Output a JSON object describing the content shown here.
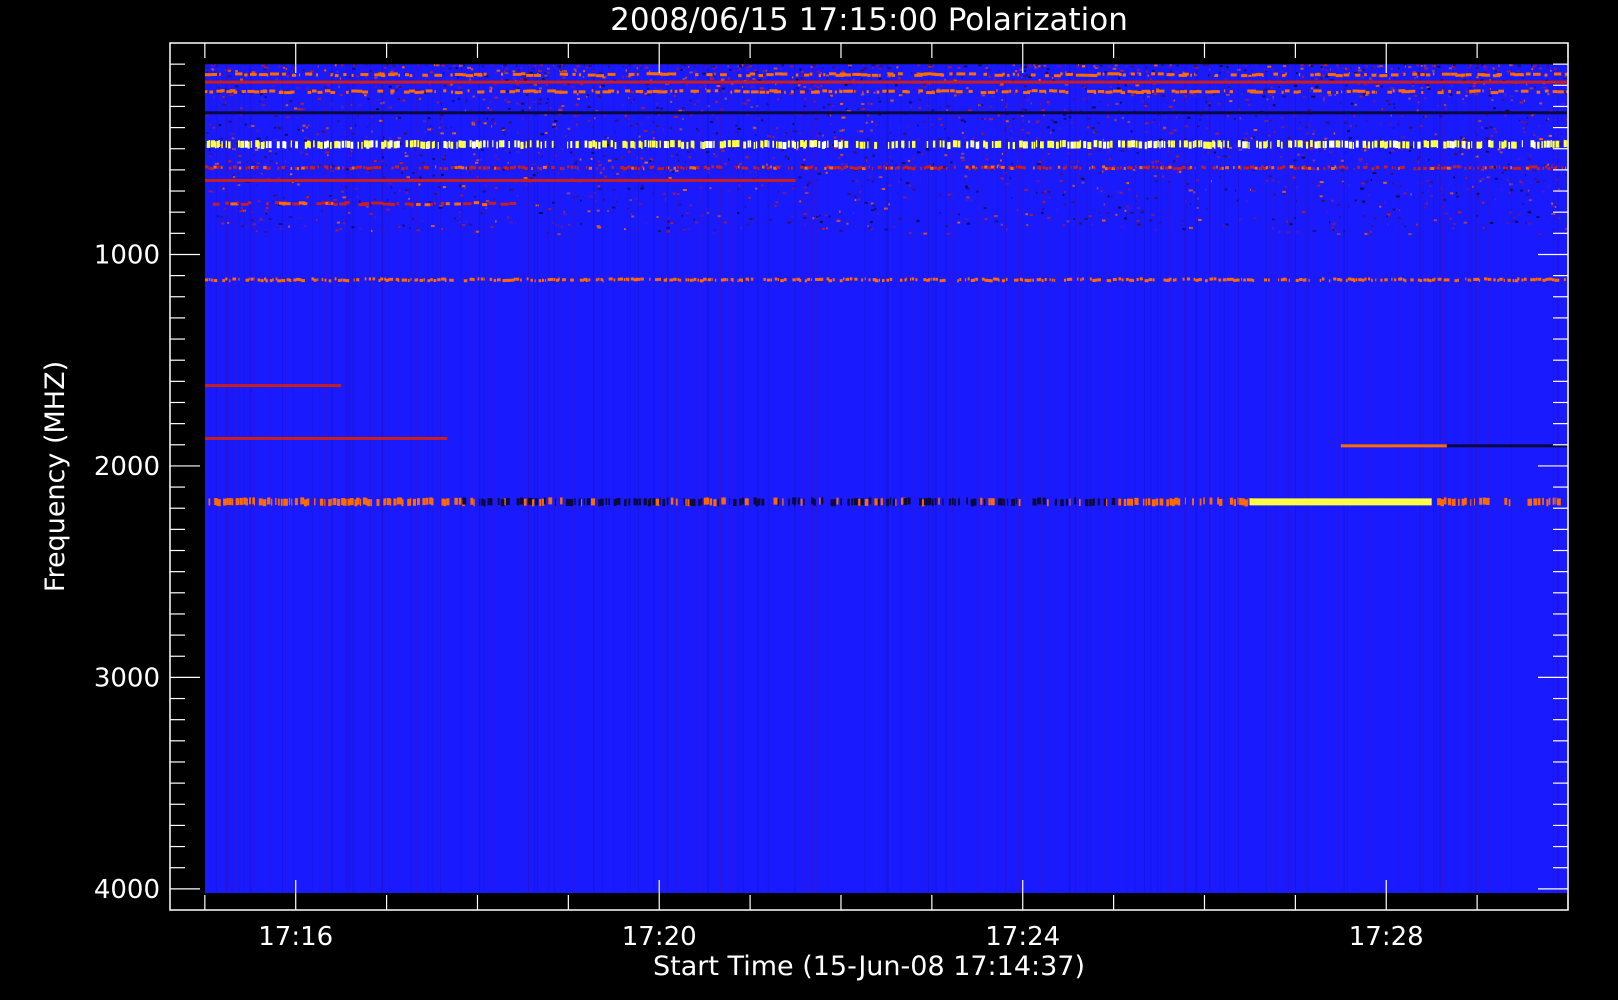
{
  "chart_data": {
    "type": "heatmap",
    "title": "2008/06/15 17:15:00 Polarization",
    "xlabel": "Start Time (15-Jun-08 17:14:37)",
    "ylabel": "Frequency (MHZ)",
    "x_axis": {
      "unit": "time",
      "range": [
        "17:14:37",
        "17:30:00"
      ],
      "data_extent": [
        "17:15:00",
        "17:30:00"
      ],
      "major_ticks": [
        "17:16",
        "17:20",
        "17:24",
        "17:28"
      ],
      "minor_tick_interval_minutes": 1
    },
    "y_axis": {
      "unit": "MHz",
      "range": [
        4100,
        0
      ],
      "data_extent": [
        100,
        4020
      ],
      "inverted": true,
      "major_ticks": [
        1000,
        2000,
        3000,
        4000
      ],
      "minor_tick_interval": 100
    },
    "background_color": "#1a1aff",
    "colors": {
      "background": "#000000",
      "axis": "#ffffff",
      "low": "#0a0a3c",
      "base": "#2424f0",
      "mid": "#c81e1e",
      "high": "#ff6a00",
      "peak": "#ffff44"
    },
    "colormap": [
      "#000000",
      "#2424f0",
      "#c81e1e",
      "#ff6a00",
      "#ffff44"
    ],
    "features": [
      {
        "freq_mhz": 150,
        "time": [
          "17:15:00",
          "17:30:00"
        ],
        "intensity": "high",
        "style": "broken"
      },
      {
        "freq_mhz": 185,
        "time": [
          "17:15:00",
          "17:30:00"
        ],
        "intensity": "mid",
        "style": "continuous"
      },
      {
        "freq_mhz": 230,
        "time": [
          "17:15:00",
          "17:30:00"
        ],
        "intensity": "high",
        "style": "broken"
      },
      {
        "freq_mhz": 330,
        "time": [
          "17:15:00",
          "17:30:00"
        ],
        "intensity": "low",
        "style": "continuous"
      },
      {
        "freq_mhz": 480,
        "time": [
          "17:15:00",
          "17:30:00"
        ],
        "intensity": "peak",
        "style": "speckled"
      },
      {
        "freq_mhz": 590,
        "time": [
          "17:15:00",
          "17:30:00"
        ],
        "intensity": "mid",
        "style": "speckled"
      },
      {
        "freq_mhz": 650,
        "time": [
          "17:15:00",
          "17:21:30"
        ],
        "intensity": "mid",
        "style": "continuous"
      },
      {
        "freq_mhz": 760,
        "time": [
          "17:15:00",
          "17:18:30"
        ],
        "intensity": "mid",
        "style": "broken"
      },
      {
        "freq_mhz": 1120,
        "time": [
          "17:15:00",
          "17:30:00"
        ],
        "intensity": "high",
        "style": "speckled"
      },
      {
        "freq_mhz": 1620,
        "time": [
          "17:15:00",
          "17:16:30"
        ],
        "intensity": "mid",
        "style": "continuous"
      },
      {
        "freq_mhz": 1870,
        "time": [
          "17:15:00",
          "17:17:40"
        ],
        "intensity": "mid",
        "style": "continuous"
      },
      {
        "freq_mhz": 1905,
        "time": [
          "17:27:30",
          "17:28:40"
        ],
        "intensity": "high",
        "style": "continuous"
      },
      {
        "freq_mhz": 1905,
        "time": [
          "17:28:40",
          "17:30:00"
        ],
        "intensity": "low",
        "style": "continuous"
      },
      {
        "freq_mhz": 2170,
        "time": [
          "17:15:00",
          "17:17:50"
        ],
        "intensity": "high",
        "style": "speckled"
      },
      {
        "freq_mhz": 2170,
        "time": [
          "17:17:50",
          "17:25:00"
        ],
        "intensity": "low",
        "style": "speckled"
      },
      {
        "freq_mhz": 2170,
        "time": [
          "17:25:00",
          "17:26:30"
        ],
        "intensity": "high",
        "style": "speckled"
      },
      {
        "freq_mhz": 2170,
        "time": [
          "17:26:30",
          "17:28:30"
        ],
        "intensity": "peak",
        "style": "continuous"
      },
      {
        "freq_mhz": 2170,
        "time": [
          "17:28:30",
          "17:30:00"
        ],
        "intensity": "high",
        "style": "speckled"
      }
    ],
    "grid": false,
    "legend": "none"
  }
}
